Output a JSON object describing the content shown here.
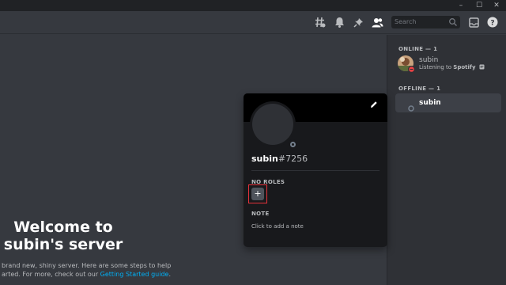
{
  "window": {
    "minimize_label": "–",
    "maximize_label": "☐",
    "close_label": "✕"
  },
  "header": {
    "icons": [
      "threads-icon",
      "notification-bell-icon",
      "pin-icon",
      "members-icon",
      "inbox-icon",
      "help-icon"
    ],
    "search_placeholder": "Search"
  },
  "members": {
    "online_heading": "ONLINE — 1",
    "offline_heading": "OFFLINE — 1",
    "online": [
      {
        "name": "subin",
        "activity_prefix": "Listening to ",
        "activity_app": "Spotify",
        "status_color": "#ed4245"
      }
    ],
    "offline": [
      {
        "name": "subin",
        "status_color": "#747f8d"
      }
    ]
  },
  "welcome": {
    "title": "Welcome to subin's server",
    "text_line1": "brand new, shiny server. Here are some steps to help",
    "text_line2_prefix": "arted. For more, check out our ",
    "text_line2_link": "Getting Started guide",
    "text_line2_suffix": "."
  },
  "profile_popout": {
    "username": "subin",
    "discriminator": "#7256",
    "roles_heading": "NO ROLES",
    "add_role_label": "+",
    "note_heading": "NOTE",
    "note_placeholder": "Click to add a note",
    "banner_color": "#000000",
    "highlight_color": "#e5323a"
  },
  "colors": {
    "app_bg": "#36393f",
    "sidebar_bg": "#2f3136",
    "popout_bg": "#18191c",
    "link": "#00aff4"
  }
}
